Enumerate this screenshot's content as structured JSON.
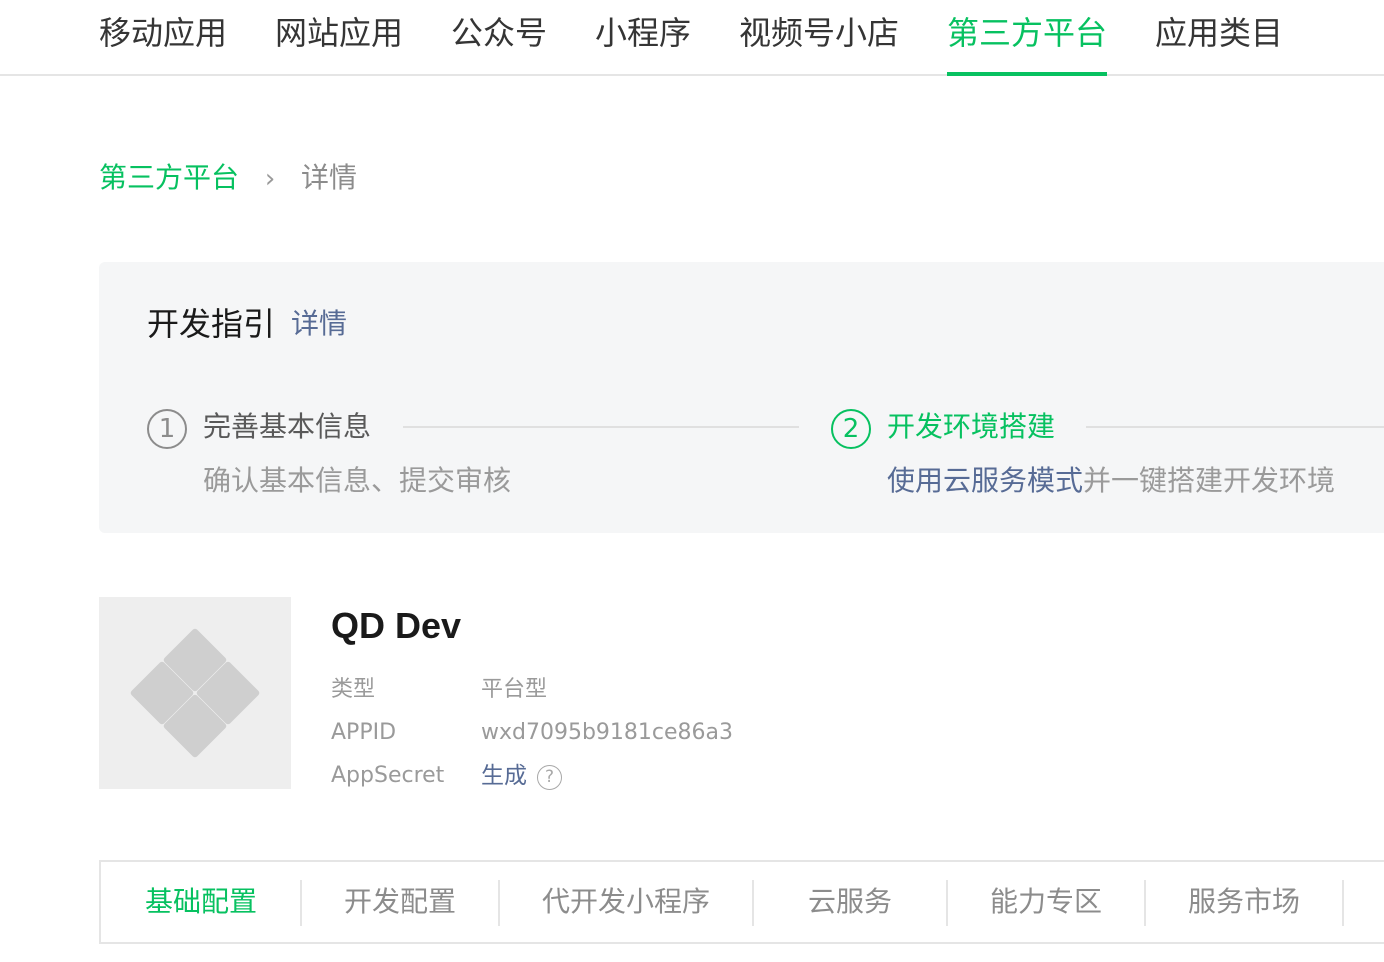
{
  "top_nav": {
    "tabs": [
      {
        "label": "移动应用"
      },
      {
        "label": "网站应用"
      },
      {
        "label": "公众号"
      },
      {
        "label": "小程序"
      },
      {
        "label": "视频号小店"
      },
      {
        "label": "第三方平台",
        "active": true
      },
      {
        "label": "应用类目"
      }
    ]
  },
  "breadcrumb": {
    "parent": "第三方平台",
    "separator_icon": "chevron-right-icon",
    "separator": "›",
    "current": "详情"
  },
  "guide": {
    "title": "开发指引",
    "detail_link": "详情",
    "steps": [
      {
        "number": "1",
        "title": "完善基本信息",
        "desc": "确认基本信息、提交审核",
        "active": false
      },
      {
        "number": "2",
        "title": "开发环境搭建",
        "desc_link": "使用云服务模式",
        "desc_rest": "并一键搭建开发环境",
        "active": true
      }
    ]
  },
  "app": {
    "logo_icon": "app-placeholder-icon",
    "name": "QD Dev",
    "fields": {
      "type_label": "类型",
      "type_value": "平台型",
      "appid_label": "APPID",
      "appid_value": "wxd7095b9181ce86a3",
      "secret_label": "AppSecret",
      "secret_action": "生成",
      "help_icon": "question-circle-icon",
      "help_glyph": "?"
    }
  },
  "sub_tabs": [
    {
      "label": "基础配置",
      "active": true
    },
    {
      "label": "开发配置"
    },
    {
      "label": "代开发小程序"
    },
    {
      "label": "云服务"
    },
    {
      "label": "能力专区"
    },
    {
      "label": "服务市场"
    }
  ],
  "colors": {
    "accent": "#07c160",
    "link": "#576b95"
  }
}
